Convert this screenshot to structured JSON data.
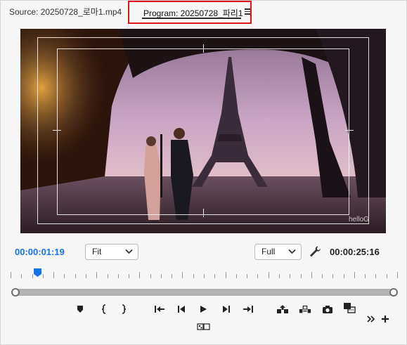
{
  "tabs": {
    "source_label": "Source: 20250728_로마1.mp4",
    "program_label": "Program: 20250728_파리1"
  },
  "viewer": {
    "watermark": "helloG"
  },
  "controls": {
    "current_timecode": "00:00:01:19",
    "fit_label": "Fit",
    "resolution_label": "Full",
    "duration_timecode": "00:00:25:16"
  },
  "playback": {
    "playhead_position_fraction": 0.06,
    "zoom_range_fraction": [
      0.0,
      1.0
    ]
  },
  "icons": {
    "tab_menu": "hamburger-icon",
    "settings": "wrench-icon",
    "transport": [
      "marker-icon",
      "mark-in-icon",
      "mark-out-icon",
      "go-to-in-icon",
      "step-back-icon",
      "play-icon",
      "step-forward-icon",
      "go-to-out-icon",
      "lift-icon",
      "extract-icon",
      "export-frame-icon",
      "insert-clip-icon"
    ],
    "compare": "comparison-view-icon",
    "overflow": "chevron-double-right-icon",
    "add": "plus-icon"
  },
  "colors": {
    "accent_timecode": "#1473e6",
    "highlight_border": "#e0141b"
  }
}
